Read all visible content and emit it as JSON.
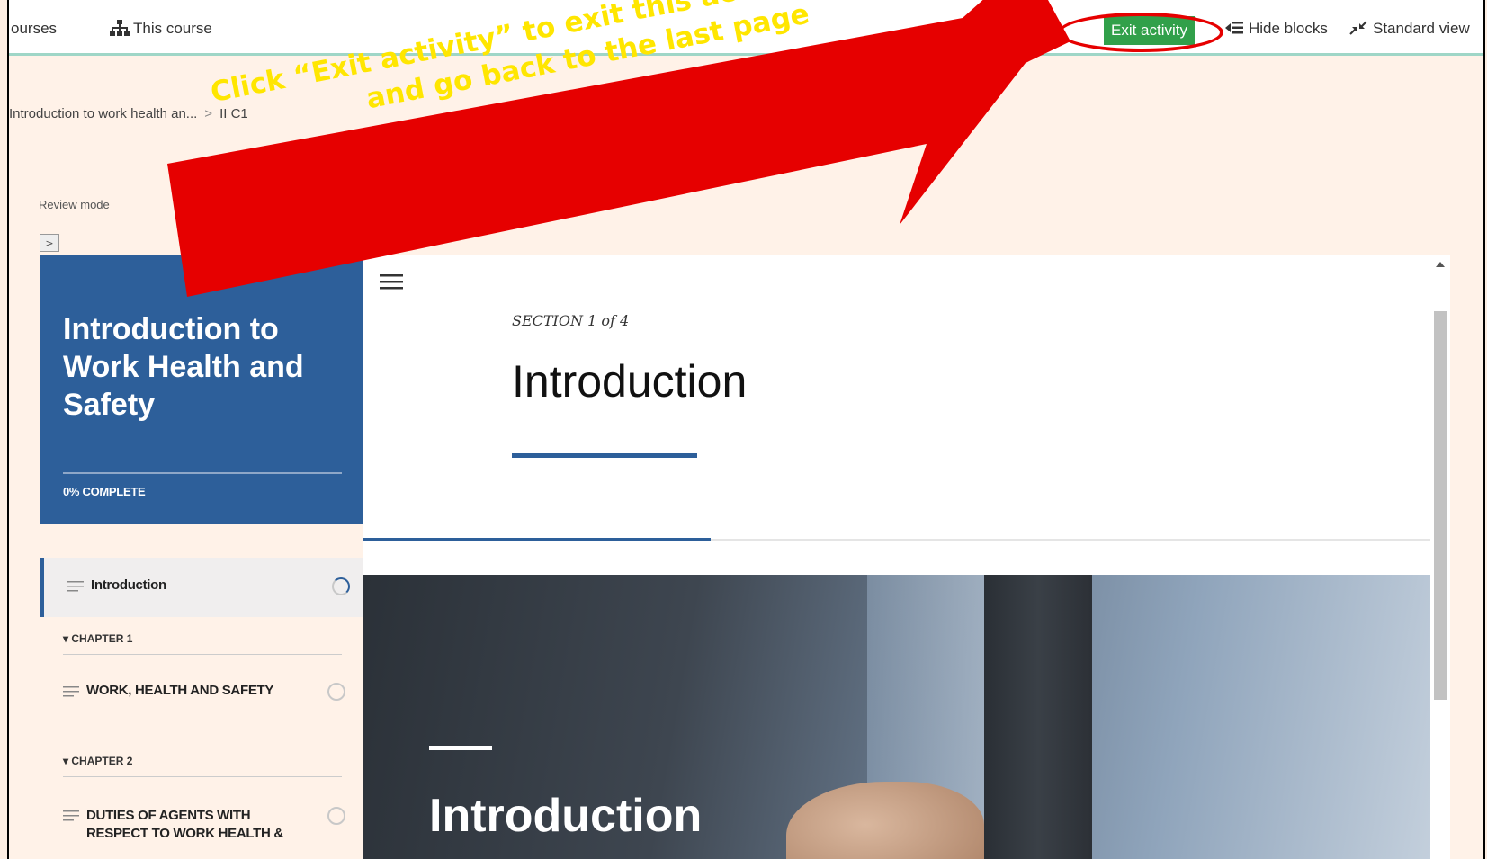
{
  "topnav": {
    "courses": "ourses",
    "this_course": "This course",
    "exit_activity": "Exit activity",
    "hide_blocks": "Hide blocks",
    "standard_view": "Standard view"
  },
  "breadcrumb": {
    "item1": "Introduction to work health an...",
    "sep": ">",
    "item2": "II C1"
  },
  "review_mode": "Review mode",
  "toggle_label": ">",
  "sidebar": {
    "course_title": "Introduction to Work Health and Safety",
    "progress": "0% COMPLETE",
    "progress_percent": 0,
    "items": [
      {
        "label": "Introduction"
      },
      {
        "chapter": "CHAPTER 1"
      },
      {
        "label": "WORK, HEALTH AND SAFETY"
      },
      {
        "chapter": "CHAPTER 2"
      },
      {
        "label": "DUTIES OF AGENTS WITH RESPECT TO WORK HEALTH &"
      }
    ]
  },
  "main": {
    "section_label": "SECTION 1 of 4",
    "title": "Introduction",
    "hero_title": "Introduction"
  },
  "callout": {
    "text_line1": "Click “Exit activity” to exit this activity anytime",
    "text_line2": "and go back to the last page",
    "color": "#e60000",
    "text_color": "#ffe600"
  }
}
